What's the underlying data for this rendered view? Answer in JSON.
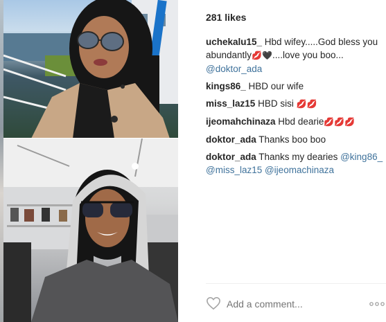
{
  "post": {
    "likes_text": "281 likes",
    "comments": [
      {
        "user": "uchekalu15_",
        "text_a": " Hbd wifey.....God bless you abundantly",
        "emoji_a": "💋",
        "emoji_b": "🖤",
        "text_b": "....love you boo... ",
        "mention": "@doktor_ada"
      },
      {
        "user": "kings86_",
        "text": " HBD our wife"
      },
      {
        "user": "miss_laz15",
        "text": " HBD sisi",
        "emoji": "💋💋"
      },
      {
        "user": "ijeomahchinaza",
        "text": " Hbd dearie",
        "emoji": "💋💋💋"
      },
      {
        "user": "doktor_ada",
        "text": " Thanks boo boo"
      },
      {
        "user": "doktor_ada",
        "text": " Thanks my dearies ",
        "mentions": "@king86_ @miss_laz15 @ijeomachinaza"
      }
    ],
    "add_comment_placeholder": "Add a comment...",
    "icons": {
      "like": "heart-outline-icon",
      "more": "more-options-icon"
    }
  }
}
